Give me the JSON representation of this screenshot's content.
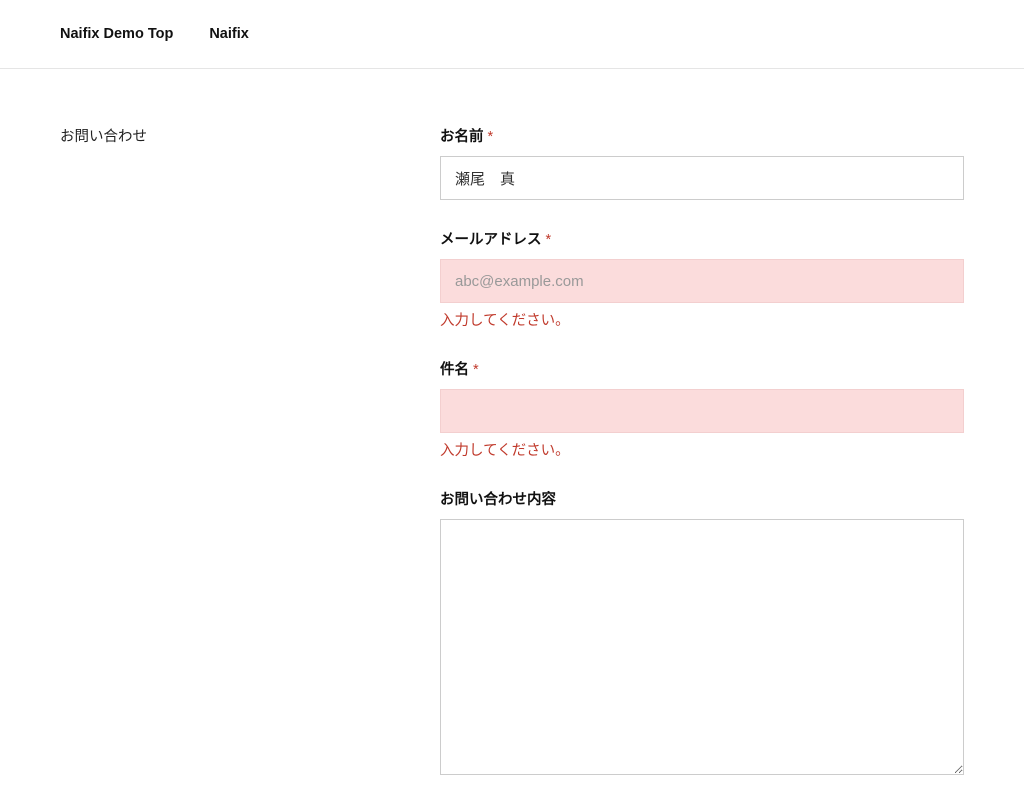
{
  "header": {
    "links": [
      {
        "label": "Naifix Demo Top"
      },
      {
        "label": "Naifix"
      }
    ]
  },
  "sidebar": {
    "title": "お問い合わせ"
  },
  "form": {
    "name": {
      "label": "お名前",
      "required_mark": "*",
      "value": "瀬尾　真"
    },
    "email": {
      "label": "メールアドレス",
      "required_mark": "*",
      "placeholder": "abc@example.com",
      "value": "",
      "error": "入力してください。"
    },
    "subject": {
      "label": "件名",
      "required_mark": "*",
      "value": "",
      "error": "入力してください。"
    },
    "message": {
      "label": "お問い合わせ内容",
      "value": ""
    }
  }
}
